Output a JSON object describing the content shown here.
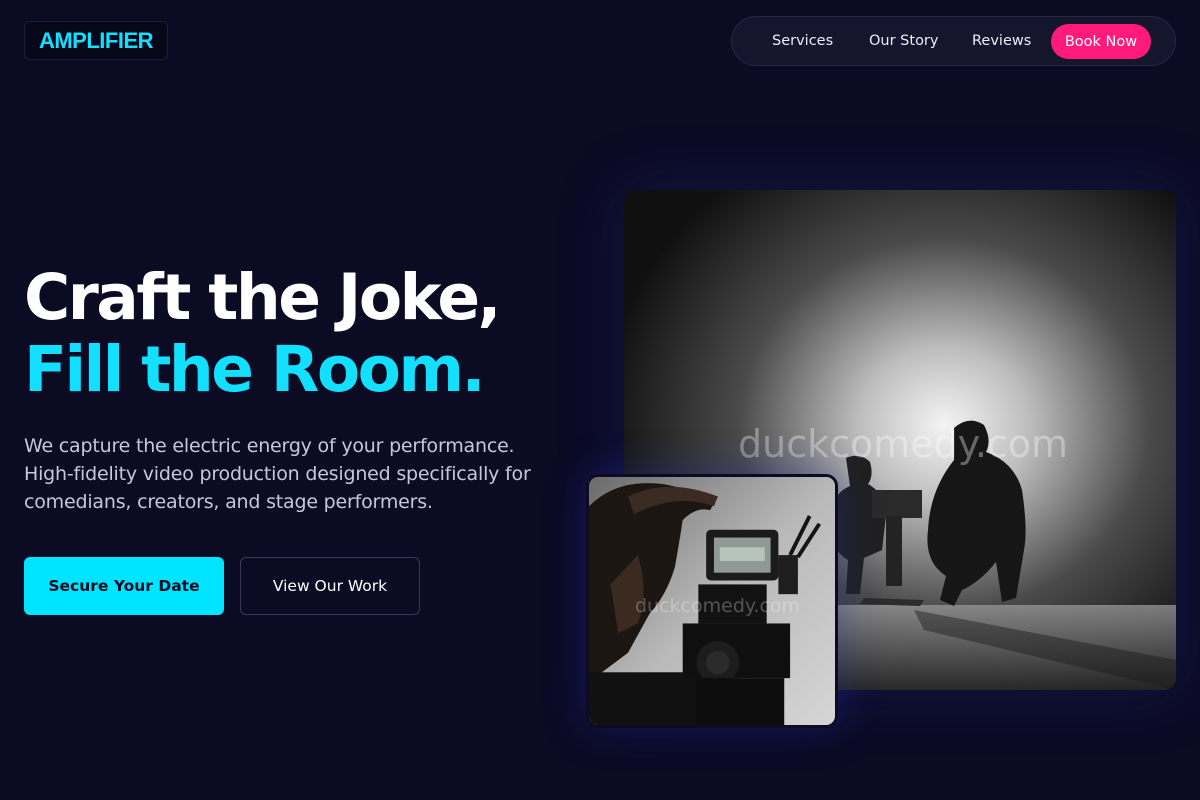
{
  "brand": {
    "logo_text": "AMPLIFIER",
    "accent": "#13e0ff",
    "cta_color": "#ff1a7c",
    "background": "#0b0b24"
  },
  "nav": {
    "items": [
      {
        "label": "Services"
      },
      {
        "label": "Our Story"
      },
      {
        "label": "Reviews"
      }
    ],
    "book_label": "Book Now"
  },
  "hero": {
    "headline_line1": "Craft the Joke,",
    "headline_line2": "Fill the Room.",
    "subtext": "We capture the electric energy of your performance. High-fidelity video production designed specifically for comedians, creators, and stage performers.",
    "primary_cta": "Secure Your Date",
    "secondary_cta": "View Our Work"
  },
  "images": {
    "main_watermark": "duckcomedy.com",
    "small_watermark": "duckcomedy.com"
  }
}
